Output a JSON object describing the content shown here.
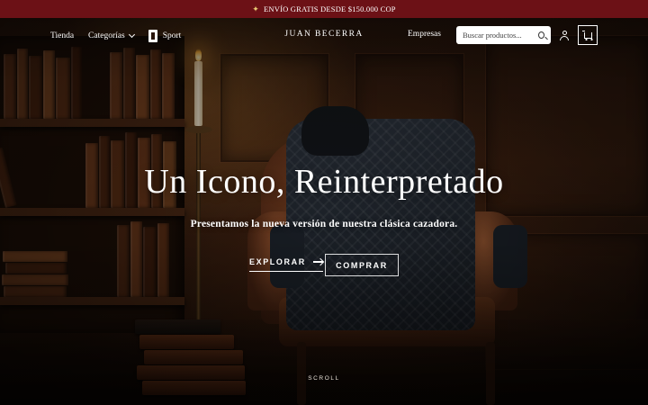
{
  "announcement": {
    "text": "ENVÍO GRATIS DESDE $150.000 COP",
    "icon": "megaphone-icon"
  },
  "header": {
    "nav": {
      "tienda": "Tienda",
      "categorias": "Categorías",
      "sport": "Sport"
    },
    "brand": "JUAN BECERRA",
    "empresas": "Empresas",
    "search": {
      "placeholder": "Buscar productos..."
    }
  },
  "hero": {
    "title": "Un Icono, Reinterpretado",
    "subtitle": "Presentamos la nueva versión de nuestra clásica cazadora.",
    "explore_label": "EXPLORAR",
    "buy_label": "COMPRAR",
    "scroll_label": "SCROLL"
  },
  "colors": {
    "announcement_bg": "#6c1116",
    "text": "#ffffff"
  }
}
